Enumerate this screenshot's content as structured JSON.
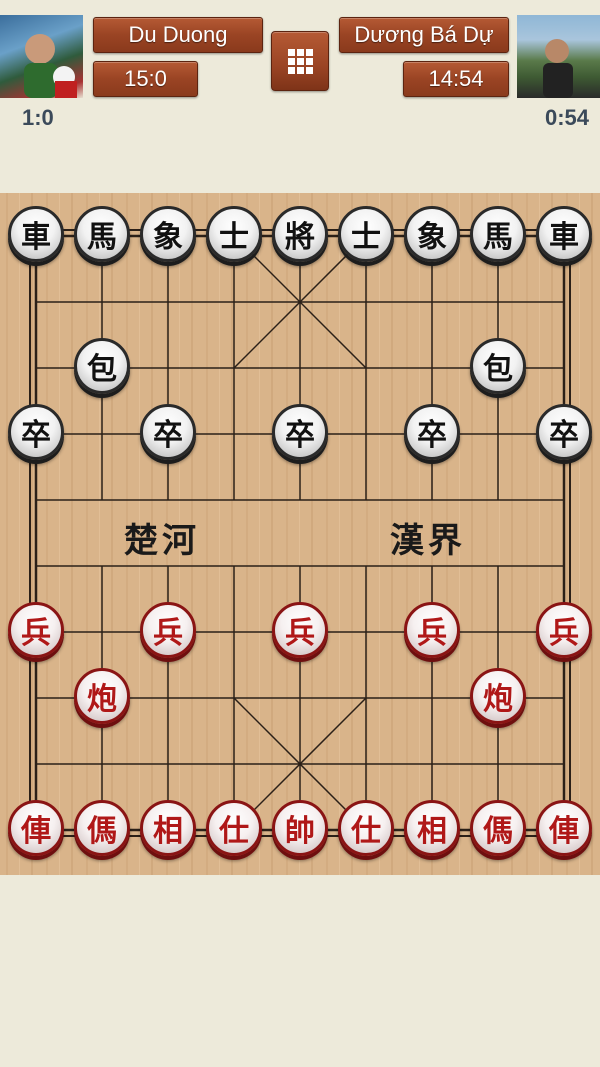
{
  "players": {
    "left": {
      "name": "Du Duong",
      "time": "15:0",
      "score": "1:0"
    },
    "right": {
      "name": "Dương Bá Dự",
      "time": "14:54",
      "score": "0:54"
    }
  },
  "board": {
    "river_left": "楚河",
    "river_right": "漢界",
    "line_color": "#2b2018",
    "wood_color": "#d9b48a",
    "black_pieces": [
      {
        "label": "車",
        "col": 0,
        "row": 0
      },
      {
        "label": "馬",
        "col": 1,
        "row": 0
      },
      {
        "label": "象",
        "col": 2,
        "row": 0
      },
      {
        "label": "士",
        "col": 3,
        "row": 0
      },
      {
        "label": "將",
        "col": 4,
        "row": 0
      },
      {
        "label": "士",
        "col": 5,
        "row": 0
      },
      {
        "label": "象",
        "col": 6,
        "row": 0
      },
      {
        "label": "馬",
        "col": 7,
        "row": 0
      },
      {
        "label": "車",
        "col": 8,
        "row": 0
      },
      {
        "label": "包",
        "col": 1,
        "row": 2
      },
      {
        "label": "包",
        "col": 7,
        "row": 2
      },
      {
        "label": "卒",
        "col": 0,
        "row": 3
      },
      {
        "label": "卒",
        "col": 2,
        "row": 3
      },
      {
        "label": "卒",
        "col": 4,
        "row": 3
      },
      {
        "label": "卒",
        "col": 6,
        "row": 3
      },
      {
        "label": "卒",
        "col": 8,
        "row": 3
      }
    ],
    "red_pieces": [
      {
        "label": "兵",
        "col": 0,
        "row": 6
      },
      {
        "label": "兵",
        "col": 2,
        "row": 6
      },
      {
        "label": "兵",
        "col": 4,
        "row": 6
      },
      {
        "label": "兵",
        "col": 6,
        "row": 6
      },
      {
        "label": "兵",
        "col": 8,
        "row": 6
      },
      {
        "label": "炮",
        "col": 1,
        "row": 7
      },
      {
        "label": "炮",
        "col": 7,
        "row": 7
      },
      {
        "label": "俥",
        "col": 0,
        "row": 9
      },
      {
        "label": "傌",
        "col": 1,
        "row": 9
      },
      {
        "label": "相",
        "col": 2,
        "row": 9
      },
      {
        "label": "仕",
        "col": 3,
        "row": 9
      },
      {
        "label": "帥",
        "col": 4,
        "row": 9
      },
      {
        "label": "仕",
        "col": 5,
        "row": 9
      },
      {
        "label": "相",
        "col": 6,
        "row": 9
      },
      {
        "label": "傌",
        "col": 7,
        "row": 9
      },
      {
        "label": "俥",
        "col": 8,
        "row": 9
      }
    ]
  }
}
